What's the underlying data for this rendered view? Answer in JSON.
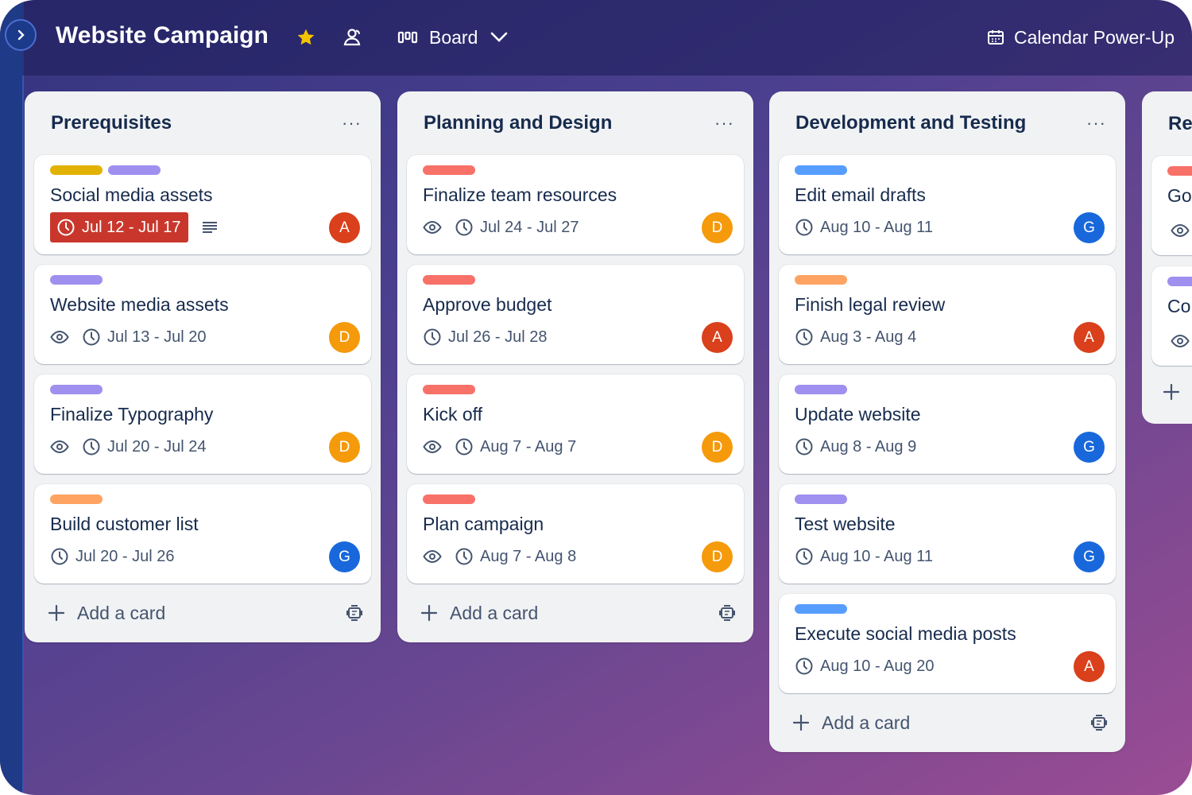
{
  "colors": {
    "yellow": "#e2b203",
    "purple": "#9f8fef",
    "red": "#f87168",
    "orange": "#fea362",
    "blue": "#579dff",
    "overdue": "#c9372c",
    "avatar_A": "#d9401b",
    "avatar_D": "#f59a0b",
    "avatar_G": "#1868db"
  },
  "header": {
    "board_title": "Website Campaign",
    "view_label": "Board",
    "powerup_label": "Calendar Power-Up",
    "icons": [
      "chevron-right-icon",
      "star-icon",
      "workspace-visible-icon",
      "board-view-icon",
      "chevron-down-icon",
      "calendar-icon"
    ]
  },
  "lists": [
    {
      "title": "Prerequisites",
      "menu": "···",
      "add_label": "Add a card",
      "cards": [
        {
          "title": "Social media assets",
          "labels": [
            "yellow",
            "purple"
          ],
          "date": "Jul 12 - Jul 17",
          "overdue": true,
          "watch": false,
          "description": true,
          "avatar": "A"
        },
        {
          "title": "Website media assets",
          "labels": [
            "purple"
          ],
          "date": "Jul 13 - Jul 20",
          "overdue": false,
          "watch": true,
          "description": false,
          "avatar": "D"
        },
        {
          "title": "Finalize Typography",
          "labels": [
            "purple"
          ],
          "date": "Jul 20 - Jul 24",
          "overdue": false,
          "watch": true,
          "description": false,
          "avatar": "D"
        },
        {
          "title": "Build customer list",
          "labels": [
            "orange"
          ],
          "date": "Jul 20 - Jul 26",
          "overdue": false,
          "watch": false,
          "description": false,
          "avatar": "G"
        }
      ]
    },
    {
      "title": "Planning and Design",
      "menu": "···",
      "add_label": "Add a card",
      "cards": [
        {
          "title": "Finalize team resources",
          "labels": [
            "red"
          ],
          "date": "Jul 24 - Jul 27",
          "overdue": false,
          "watch": true,
          "description": false,
          "avatar": "D"
        },
        {
          "title": "Approve budget",
          "labels": [
            "red"
          ],
          "date": "Jul 26 - Jul 28",
          "overdue": false,
          "watch": false,
          "description": false,
          "avatar": "A"
        },
        {
          "title": "Kick off",
          "labels": [
            "red"
          ],
          "date": "Aug 7 - Aug 7",
          "overdue": false,
          "watch": true,
          "description": false,
          "avatar": "D"
        },
        {
          "title": "Plan campaign",
          "labels": [
            "red"
          ],
          "date": "Aug 7 - Aug 8",
          "overdue": false,
          "watch": true,
          "description": false,
          "avatar": "D"
        }
      ]
    },
    {
      "title": "Development and Testing",
      "menu": "···",
      "add_label": "Add a card",
      "cards": [
        {
          "title": "Edit email drafts",
          "labels": [
            "blue"
          ],
          "date": "Aug 10 - Aug 11",
          "overdue": false,
          "watch": false,
          "description": false,
          "avatar": "G"
        },
        {
          "title": "Finish legal review",
          "labels": [
            "orange"
          ],
          "date": "Aug 3 - Aug 4",
          "overdue": false,
          "watch": false,
          "description": false,
          "avatar": "A"
        },
        {
          "title": "Update website",
          "labels": [
            "purple"
          ],
          "date": "Aug 8 - Aug 9",
          "overdue": false,
          "watch": false,
          "description": false,
          "avatar": "G"
        },
        {
          "title": "Test website",
          "labels": [
            "purple"
          ],
          "date": "Aug 10 - Aug 11",
          "overdue": false,
          "watch": false,
          "description": false,
          "avatar": "G"
        },
        {
          "title": "Execute social media posts",
          "labels": [
            "blue"
          ],
          "date": "Aug 10 - Aug 20",
          "overdue": false,
          "watch": false,
          "description": false,
          "avatar": "A"
        }
      ]
    }
  ],
  "partial_list": {
    "title": "Re",
    "cards": [
      {
        "title": "Go",
        "label": "red",
        "watch": true
      },
      {
        "title": "Co",
        "label": "purple",
        "watch": true
      }
    ]
  }
}
